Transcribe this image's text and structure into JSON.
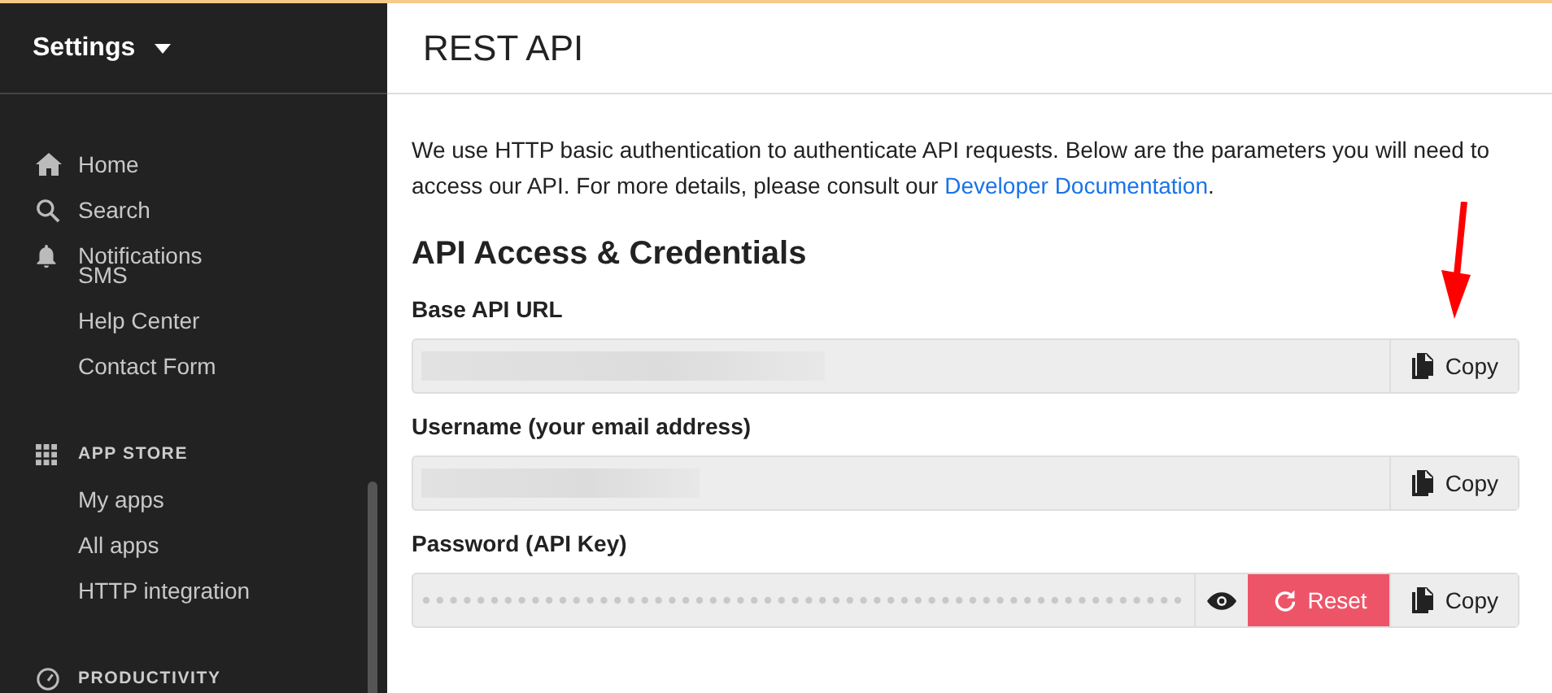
{
  "sidebar": {
    "title": "Settings",
    "items": [
      {
        "label": "Home"
      },
      {
        "label": "Search"
      },
      {
        "label": "Notifications"
      },
      {
        "label": "SMS"
      },
      {
        "label": "Help Center"
      },
      {
        "label": "Contact Form"
      }
    ],
    "sections": [
      {
        "title": "APP STORE",
        "items": [
          {
            "label": "My apps"
          },
          {
            "label": "All apps"
          },
          {
            "label": "HTTP integration"
          }
        ]
      },
      {
        "title": "PRODUCTIVITY"
      }
    ]
  },
  "page": {
    "title": "REST API",
    "intro": "We use HTTP basic authentication to authenticate API requests. Below are the parameters you will need to access our API. For more details, please consult our ",
    "intro_link": "Developer Documentation",
    "intro_end": ".",
    "heading": "API Access & Credentials",
    "fields": [
      {
        "label": "Base API URL",
        "kind": "redacted",
        "buttons": [
          {
            "kind": "copy",
            "label": "Copy"
          }
        ]
      },
      {
        "label": "Username (your email address)",
        "kind": "redacted",
        "buttons": [
          {
            "kind": "copy",
            "label": "Copy"
          }
        ]
      },
      {
        "label": "Password (API Key)",
        "kind": "masked",
        "buttons": [
          {
            "kind": "reveal"
          },
          {
            "kind": "reset",
            "label": "Reset"
          },
          {
            "kind": "copy",
            "label": "Copy"
          }
        ]
      }
    ]
  }
}
